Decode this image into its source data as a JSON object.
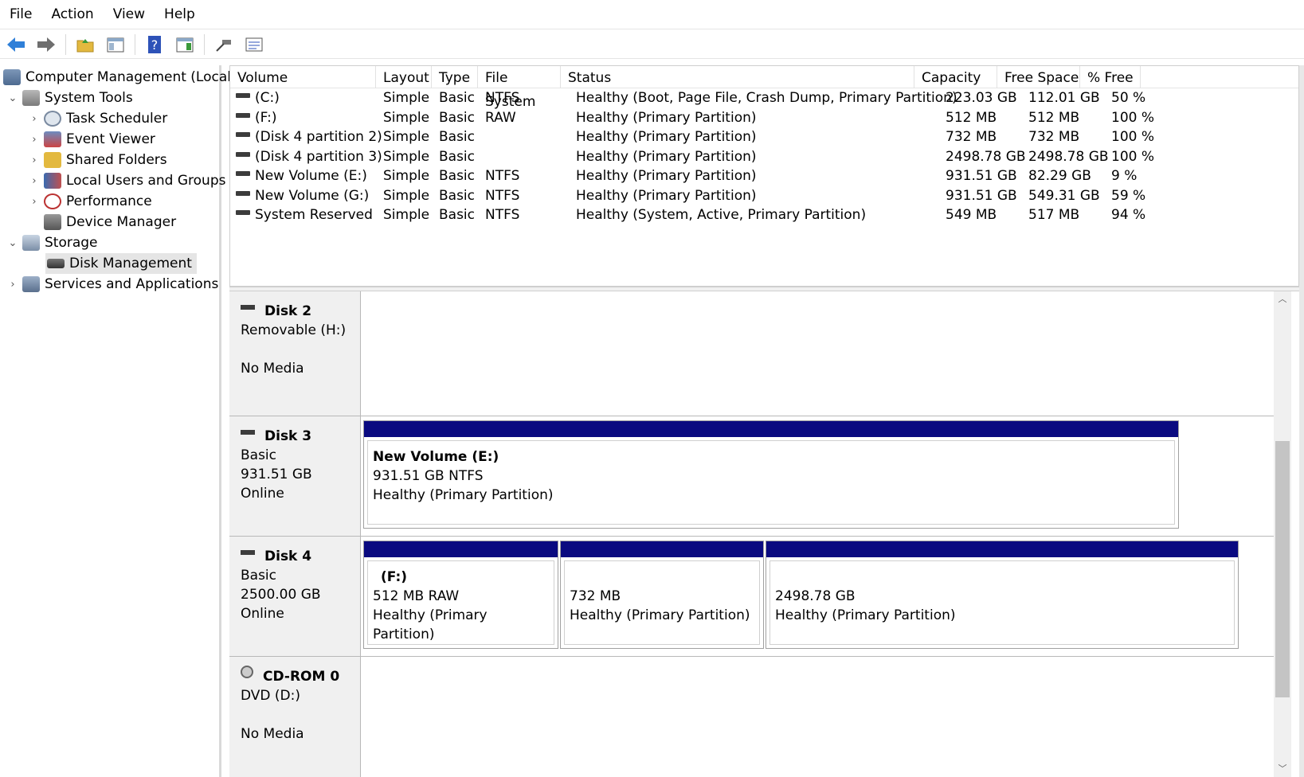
{
  "menu": [
    "File",
    "Action",
    "View",
    "Help"
  ],
  "toolbar": {
    "buttons": [
      "back-icon",
      "forward-icon",
      "up-folder-icon",
      "show-hide-tree-icon",
      "help-icon",
      "show-action-pane-icon",
      "connect-icon",
      "properties-icon"
    ],
    "colors": {
      "arrow": "#2f7fd8",
      "folder": "#e3b93f",
      "help": "#2d52b8"
    }
  },
  "tree": {
    "root": "Computer Management (Local)",
    "system_tools": "System Tools",
    "task_scheduler": "Task Scheduler",
    "event_viewer": "Event Viewer",
    "shared_folders": "Shared Folders",
    "local_users": "Local Users and Groups",
    "performance": "Performance",
    "device_manager": "Device Manager",
    "storage": "Storage",
    "disk_management": "Disk Management",
    "services": "Services and Applications"
  },
  "volumes": {
    "headers": [
      "Volume",
      "Layout",
      "Type",
      "File System",
      "Status",
      "Capacity",
      "Free Space",
      "% Free"
    ],
    "rows": [
      {
        "volume": "(C:)",
        "layout": "Simple",
        "type": "Basic",
        "fs": "NTFS",
        "status": "Healthy (Boot, Page File, Crash Dump, Primary Partition)",
        "capacity": "223.03 GB",
        "free": "112.01 GB",
        "pct": "50 %"
      },
      {
        "volume": "(F:)",
        "layout": "Simple",
        "type": "Basic",
        "fs": "RAW",
        "status": "Healthy (Primary Partition)",
        "capacity": "512 MB",
        "free": "512 MB",
        "pct": "100 %"
      },
      {
        "volume": "(Disk 4 partition 2)",
        "layout": "Simple",
        "type": "Basic",
        "fs": "",
        "status": "Healthy (Primary Partition)",
        "capacity": "732 MB",
        "free": "732 MB",
        "pct": "100 %"
      },
      {
        "volume": "(Disk 4 partition 3)",
        "layout": "Simple",
        "type": "Basic",
        "fs": "",
        "status": "Healthy (Primary Partition)",
        "capacity": "2498.78 GB",
        "free": "2498.78 GB",
        "pct": "100 %"
      },
      {
        "volume": "New Volume (E:)",
        "layout": "Simple",
        "type": "Basic",
        "fs": "NTFS",
        "status": "Healthy (Primary Partition)",
        "capacity": "931.51 GB",
        "free": "82.29 GB",
        "pct": "9 %"
      },
      {
        "volume": "New Volume (G:)",
        "layout": "Simple",
        "type": "Basic",
        "fs": "NTFS",
        "status": "Healthy (Primary Partition)",
        "capacity": "931.51 GB",
        "free": "549.31 GB",
        "pct": "59 %"
      },
      {
        "volume": "System Reserved",
        "layout": "Simple",
        "type": "Basic",
        "fs": "NTFS",
        "status": "Healthy (System, Active, Primary Partition)",
        "capacity": "549 MB",
        "free": "517 MB",
        "pct": "94 %"
      }
    ]
  },
  "disks": {
    "disk2": {
      "name": "Disk 2",
      "line1": "Removable (H:)",
      "line2": "",
      "line3": "No Media"
    },
    "disk3": {
      "name": "Disk 3",
      "line1": "Basic",
      "line2": "931.51 GB",
      "line3": "Online",
      "p1": {
        "title": "New Volume  (E:)",
        "size": "931.51 GB NTFS",
        "status": "Healthy (Primary Partition)"
      }
    },
    "disk4": {
      "name": "Disk 4",
      "line1": "Basic",
      "line2": "2500.00 GB",
      "line3": "Online",
      "p1": {
        "title": "(F:)",
        "size": "512 MB RAW",
        "status": "Healthy (Primary Partition)"
      },
      "p2": {
        "size": "732 MB",
        "status": "Healthy (Primary Partition)"
      },
      "p3": {
        "size": "2498.78 GB",
        "status": "Healthy (Primary Partition)"
      }
    },
    "cdrom": {
      "name": "CD-ROM 0",
      "line1": "DVD (D:)",
      "line2": "",
      "line3": "No Media"
    }
  },
  "colors": {
    "partition_bar": "#0a0a80",
    "selection": "#e5e5e5"
  }
}
